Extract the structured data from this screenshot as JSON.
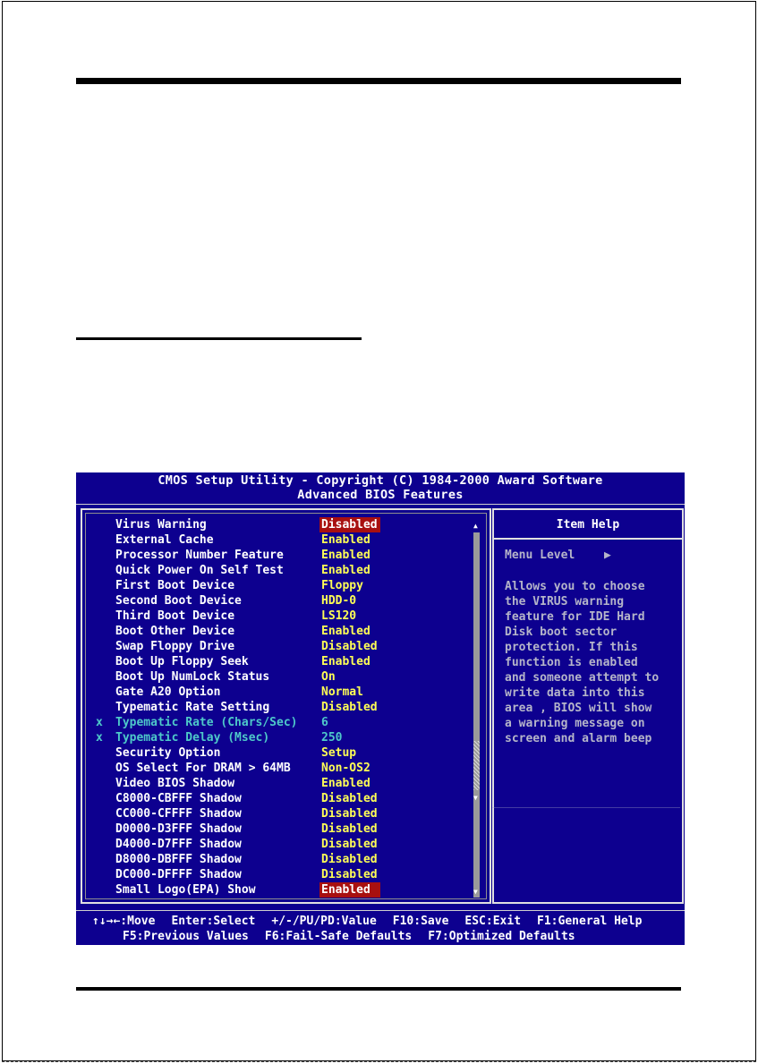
{
  "bios": {
    "title_line1": "CMOS Setup Utility - Copyright (C) 1984-2000 Award Software",
    "title_line2": "Advanced BIOS Features",
    "items": [
      {
        "mark": "",
        "label": "Virus Warning",
        "value": "Disabled",
        "state": "selected"
      },
      {
        "mark": "",
        "label": "External Cache",
        "value": "Enabled",
        "state": "normal"
      },
      {
        "mark": "",
        "label": "Processor Number Feature",
        "value": "Enabled",
        "state": "normal"
      },
      {
        "mark": "",
        "label": "Quick Power On Self Test",
        "value": "Enabled",
        "state": "normal"
      },
      {
        "mark": "",
        "label": "First Boot Device",
        "value": "Floppy",
        "state": "normal"
      },
      {
        "mark": "",
        "label": "Second Boot Device",
        "value": "HDD-0",
        "state": "normal"
      },
      {
        "mark": "",
        "label": "Third Boot Device",
        "value": "LS120",
        "state": "normal"
      },
      {
        "mark": "",
        "label": "Boot Other Device",
        "value": "Enabled",
        "state": "normal"
      },
      {
        "mark": "",
        "label": "Swap Floppy Drive",
        "value": "Disabled",
        "state": "normal"
      },
      {
        "mark": "",
        "label": "Boot Up Floppy Seek",
        "value": "Enabled",
        "state": "normal"
      },
      {
        "mark": "",
        "label": "Boot Up NumLock Status",
        "value": "On",
        "state": "normal"
      },
      {
        "mark": "",
        "label": "Gate A20 Option",
        "value": "Normal",
        "state": "normal"
      },
      {
        "mark": "",
        "label": "Typematic Rate Setting",
        "value": "Disabled",
        "state": "normal"
      },
      {
        "mark": "x",
        "label": "Typematic Rate (Chars/Sec)",
        "value": "6",
        "state": "disabled"
      },
      {
        "mark": "x",
        "label": "Typematic Delay (Msec)",
        "value": "250",
        "state": "disabled"
      },
      {
        "mark": "",
        "label": "Security Option",
        "value": "Setup",
        "state": "normal"
      },
      {
        "mark": "",
        "label": "OS Select For DRAM > 64MB",
        "value": "Non-OS2",
        "state": "normal"
      },
      {
        "mark": "",
        "label": "Video BIOS Shadow",
        "value": "Enabled",
        "state": "normal"
      },
      {
        "mark": "",
        "label": "C8000-CBFFF Shadow",
        "value": "Disabled",
        "state": "normal"
      },
      {
        "mark": "",
        "label": "CC000-CFFFF Shadow",
        "value": "Disabled",
        "state": "normal"
      },
      {
        "mark": "",
        "label": "D0000-D3FFF Shadow",
        "value": "Disabled",
        "state": "normal"
      },
      {
        "mark": "",
        "label": "D4000-D7FFF Shadow",
        "value": "Disabled",
        "state": "normal"
      },
      {
        "mark": "",
        "label": "D8000-DBFFF Shadow",
        "value": "Disabled",
        "state": "normal"
      },
      {
        "mark": "",
        "label": "DC000-DFFFF Shadow",
        "value": "Disabled",
        "state": "normal"
      },
      {
        "mark": "",
        "label": "Small Logo(EPA) Show",
        "value": "Enabled",
        "state": "selected"
      }
    ],
    "help": {
      "title": "Item Help",
      "menu_level": "Menu Level",
      "menu_level_icon": "triangle-right-icon",
      "lines": [
        "Allows you to choose",
        "the VIRUS warning",
        "feature for IDE Hard",
        "Disk boot sector",
        "protection. If this",
        "function is enabled",
        "and someone attempt to",
        "write data into this",
        "area , BIOS will show",
        "a warning message on",
        "screen and alarm beep"
      ]
    },
    "footer_row1": [
      "↑↓→←:Move",
      "Enter:Select",
      "+/-/PU/PD:Value",
      "F10:Save",
      "ESC:Exit",
      "F1:General Help"
    ],
    "footer_row2": [
      "F5:Previous Values",
      "F6:Fail-Safe Defaults",
      "F7:Optimized Defaults"
    ],
    "colors": {
      "background": "#0d008f",
      "value": "#ffff55",
      "selected_bg": "#a81010",
      "disabled": "#4ec9c9",
      "help_text": "#b5b5c9"
    }
  }
}
